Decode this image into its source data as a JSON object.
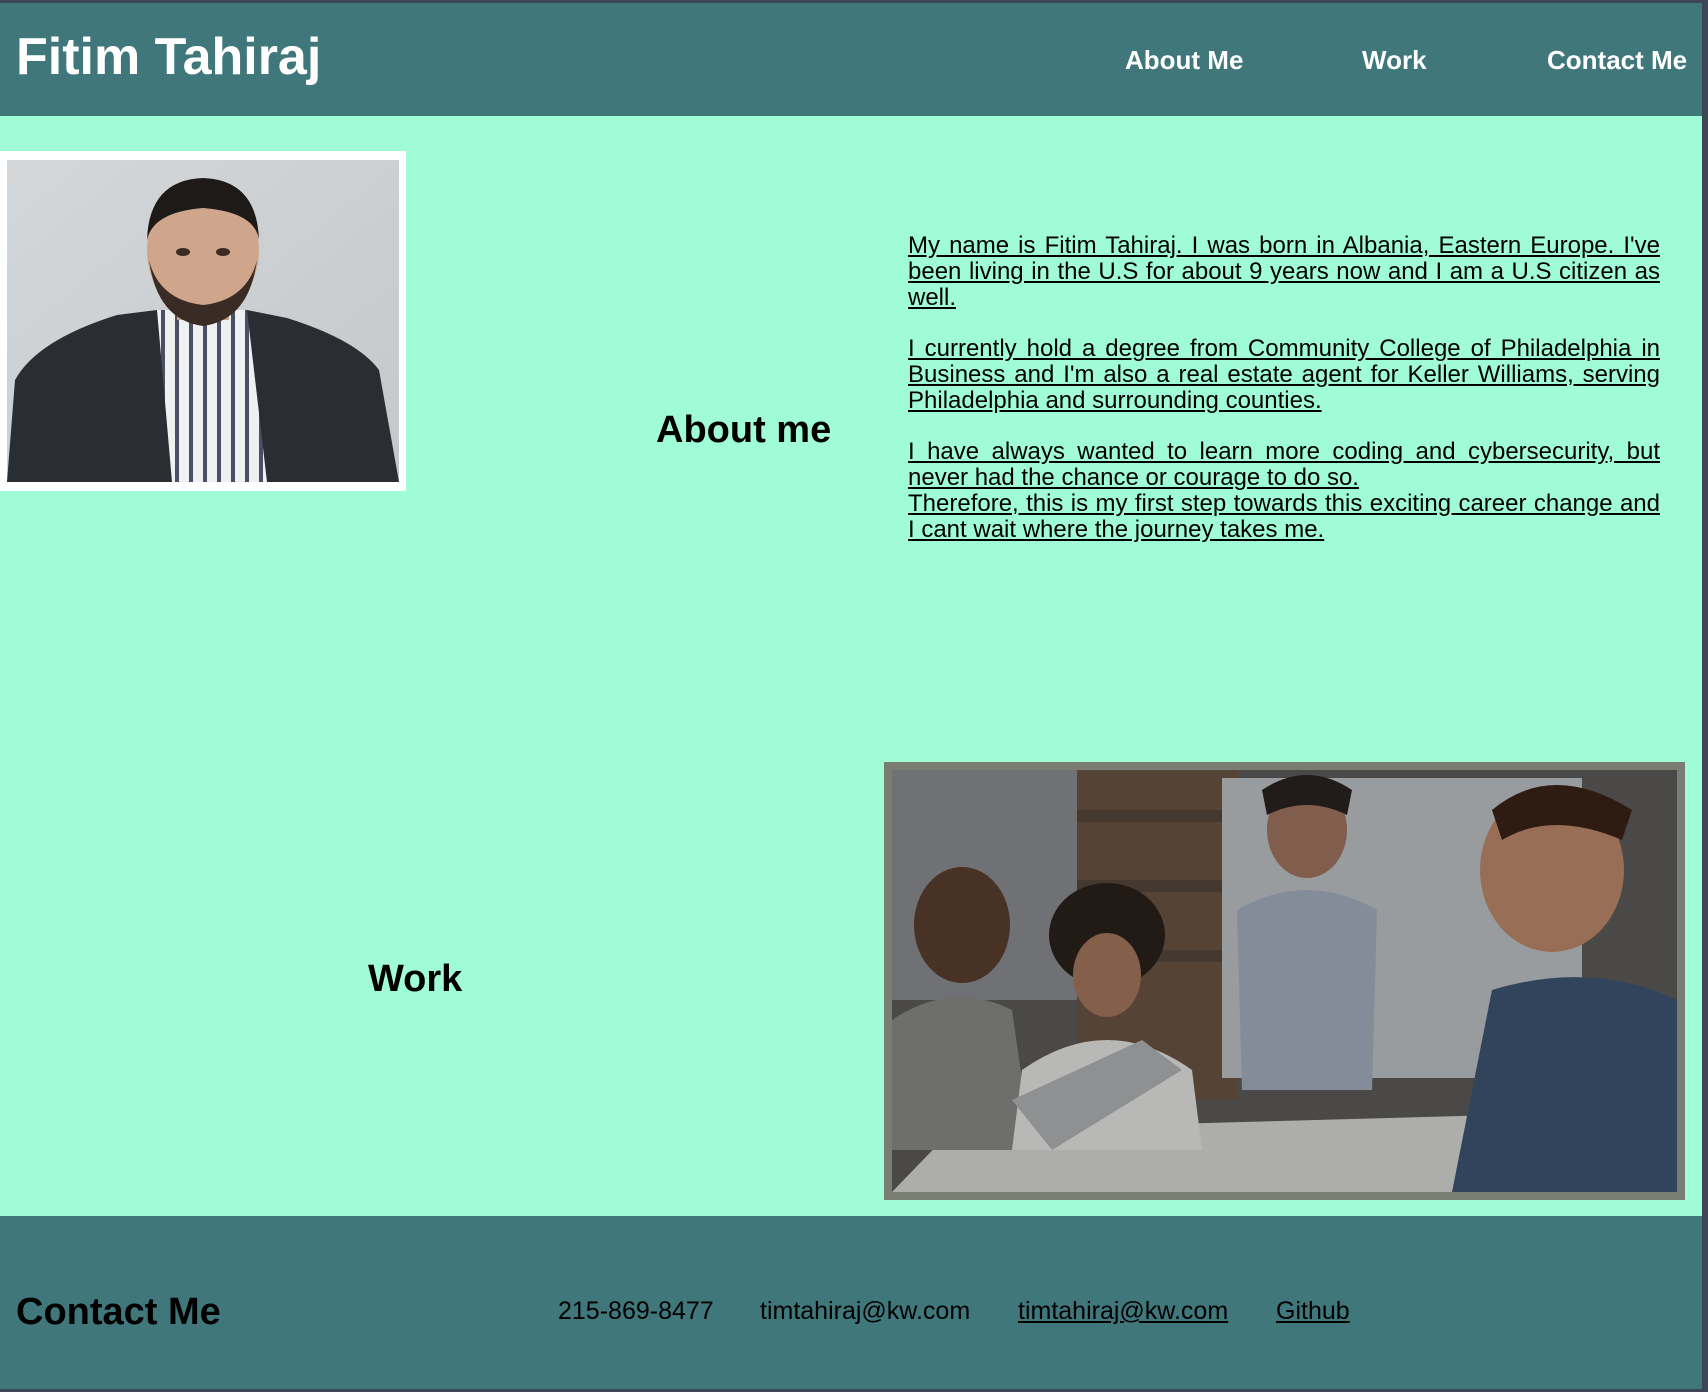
{
  "header": {
    "title": "Fitim Tahiraj",
    "nav": [
      "About Me",
      "Work",
      "Contact Me"
    ]
  },
  "about": {
    "title": "About me",
    "paragraphs": [
      [
        "My name is Fitim Tahiraj. I was born in Albania, Eastern Europe. I've been living in the U.S for about 9 years now and I am a U.S citizen as well."
      ],
      [
        "I currently hold a degree from Community College of Philadelphia in Business and I'm also a real estate agent for Keller Williams, serving Philadelphia and surrounding counties."
      ],
      [
        "I have always wanted to learn more coding and cybersecurity, but never had the chance or courage to do so.",
        "Therefore, this is my first step towards this exciting career change and I cant wait where the journey takes me."
      ]
    ]
  },
  "work": {
    "title": "Work"
  },
  "contact": {
    "title": "Contact Me",
    "phone": "215-869-8477",
    "email_text": "timtahiraj@kw.com",
    "email_link": "timtahiraj@kw.com",
    "github": "Github"
  },
  "colors": {
    "header_bg": "#3f777b",
    "page_bg": "#a0fbd7",
    "nav_text": "#ffffff",
    "body_text": "#000000"
  }
}
